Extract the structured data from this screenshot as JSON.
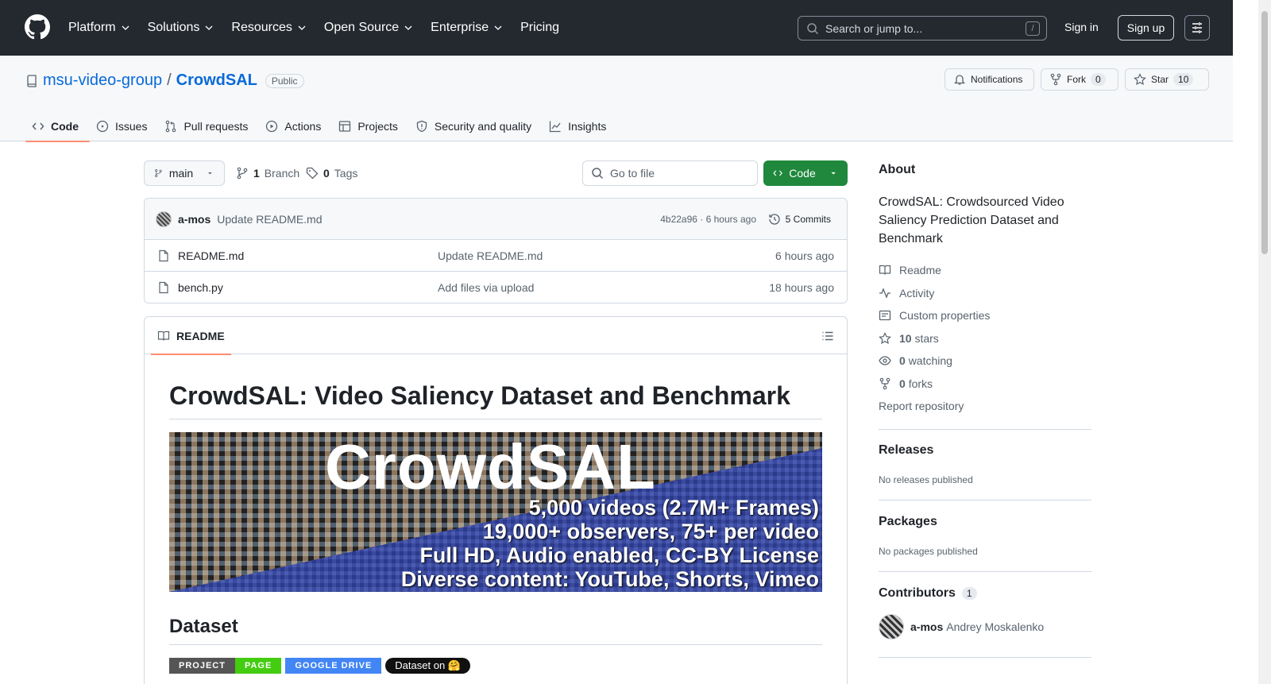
{
  "nav": {
    "items": [
      {
        "label": "Platform",
        "dropdown": true
      },
      {
        "label": "Solutions",
        "dropdown": true
      },
      {
        "label": "Resources",
        "dropdown": true
      },
      {
        "label": "Open Source",
        "dropdown": true
      },
      {
        "label": "Enterprise",
        "dropdown": true
      },
      {
        "label": "Pricing",
        "dropdown": false
      }
    ],
    "search_placeholder": "Search or jump to...",
    "search_key": "/",
    "signin": "Sign in",
    "signup": "Sign up"
  },
  "repo": {
    "owner": "msu-video-group",
    "separator": "/",
    "name": "CrowdSAL",
    "visibility": "Public",
    "notifications": "Notifications",
    "fork_label": "Fork",
    "fork_count": "0",
    "star_label": "Star",
    "star_count": "10"
  },
  "tabs": [
    {
      "label": "Code",
      "active": true
    },
    {
      "label": "Issues"
    },
    {
      "label": "Pull requests"
    },
    {
      "label": "Actions"
    },
    {
      "label": "Projects"
    },
    {
      "label": "Security and quality"
    },
    {
      "label": "Insights"
    }
  ],
  "toolbar": {
    "branch": "main",
    "branch_count": "1",
    "branch_label": "Branch",
    "tag_count": "0",
    "tag_label": "Tags",
    "goto_placeholder": "Go to file",
    "code_label": "Code"
  },
  "commit": {
    "author": "a-mos",
    "message": "Update README.md",
    "hash_time": "4b22a96 · 6 hours ago",
    "commits": "5 Commits"
  },
  "files": [
    {
      "name": "README.md",
      "message": "Update README.md",
      "age": "6 hours ago"
    },
    {
      "name": "bench.py",
      "message": "Add files via upload",
      "age": "18 hours ago"
    }
  ],
  "readme": {
    "tab": "README",
    "title": "CrowdSAL: Video Saliency Dataset and Benchmark",
    "banner_title": "CrowdSAL",
    "banner_lines": [
      "5,000 videos (2.7M+ Frames)",
      "19,000+ observers, 75+ per video",
      "Full HD, Audio enabled, CC-BY License",
      "Diverse content: YouTube, Shorts, Vimeo"
    ],
    "section": "Dataset",
    "shield1_left": "PROJECT",
    "shield1_right": "PAGE",
    "shield2": "GOOGLE DRIVE",
    "shield3": "Dataset on 🤗"
  },
  "about": {
    "heading": "About",
    "description": "CrowdSAL: Crowdsourced Video Saliency Prediction Dataset and Benchmark",
    "readme": "Readme",
    "activity": "Activity",
    "custom_props": "Custom properties",
    "stars_count": "10",
    "stars_label": "stars",
    "watching_count": "0",
    "watching_label": "watching",
    "forks_count": "0",
    "forks_label": "forks",
    "report": "Report repository"
  },
  "releases": {
    "heading": "Releases",
    "text": "No releases published"
  },
  "packages": {
    "heading": "Packages",
    "text": "No packages published"
  },
  "contributors": {
    "heading": "Contributors",
    "count": "1",
    "login": "a-mos",
    "fullname": "Andrey Moskalenko"
  },
  "colors": {
    "accent_green": "#1f883d",
    "link_blue": "#0969da",
    "header_dark": "#24292f",
    "tab_underline": "#fd8c73"
  }
}
